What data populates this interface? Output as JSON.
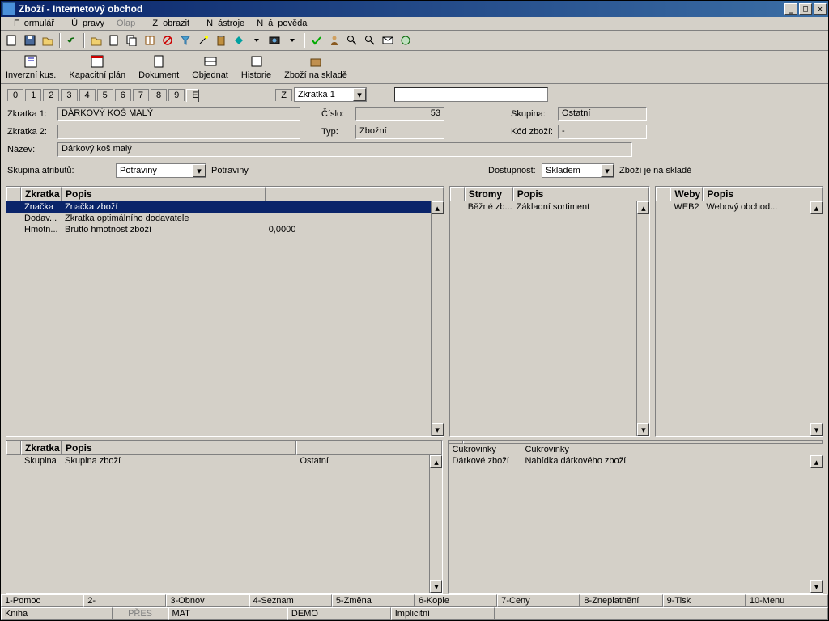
{
  "title": "Zboží - Internetový obchod",
  "menu": [
    "Formulář",
    "Úpravy",
    "Olap",
    "Zobrazit",
    "Nástroje",
    "Nápověda"
  ],
  "menu_underline": [
    0,
    0,
    null,
    0,
    0,
    1
  ],
  "actions": [
    "Inverzní kus.",
    "Kapacitní plán",
    "Dokument",
    "Objednat",
    "Historie",
    "Zboží na skladě"
  ],
  "tabs": [
    "0",
    "1",
    "2",
    "3",
    "4",
    "5",
    "6",
    "7",
    "8",
    "9",
    "E"
  ],
  "tab_active": 10,
  "zbtn": "Z",
  "zdropdown": "Zkratka 1",
  "form": {
    "zkratka1_label": "Zkratka 1:",
    "zkratka1_value": "DÁRKOVÝ KOŠ MALÝ",
    "cislo_label": "Číslo:",
    "cislo_value": "53",
    "skupina_label": "Skupina:",
    "skupina_value": "Ostatní",
    "zkratka2_label": "Zkratka 2:",
    "zkratka2_value": "",
    "typ_label": "Typ:",
    "typ_value": "Zbožní",
    "kod_label": "Kód zboží:",
    "kod_value": "-",
    "nazev_label": "Název:",
    "nazev_value": "Dárkový koš malý"
  },
  "attr_label": "Skupina atributů:",
  "attr_value": "Potraviny",
  "attr_text": "Potraviny",
  "avail_label": "Dostupnost:",
  "avail_value": "Skladem",
  "avail_text": "Zboží je na skladě",
  "grid1": {
    "cols": [
      "Zkratka",
      "Popis",
      ""
    ],
    "rows": [
      {
        "c0": "Značka",
        "c1": "Značka zboží",
        "c2": "",
        "sel": true
      },
      {
        "c0": "Dodav...",
        "c1": "Zkratka optimálního dodavatele",
        "c2": ""
      },
      {
        "c0": "Hmotn...",
        "c1": "Brutto hmotnost zboží",
        "c2": "0,0000"
      }
    ]
  },
  "grid2": {
    "cols": [
      "Stromy",
      "Popis"
    ],
    "rows": [
      {
        "c0": "Běžné zb...",
        "c1": "Základní sortiment"
      }
    ]
  },
  "grid3": {
    "cols": [
      "Weby",
      "Popis"
    ],
    "rows": [
      {
        "c0": "WEB2",
        "c1": "Webový obchod..."
      }
    ]
  },
  "grid4": {
    "cols": [
      "Zkratka",
      "Popis",
      ""
    ],
    "rows": [
      {
        "c0": "Skupina",
        "c1": "Skupina zboží",
        "c2": "Ostatní"
      }
    ]
  },
  "grid5": {
    "rows": [
      {
        "c0": "Cukrovinky",
        "c1": "Cukrovinky"
      },
      {
        "c0": "Dárkové zboží",
        "c1": "Nabídka dárkového zboží"
      }
    ]
  },
  "footer1": [
    "1-Pomoc",
    "2-",
    "3-Obnov",
    "4-Seznam",
    "5-Změna",
    "6-Kopie",
    "7-Ceny",
    "8-Zneplatnění",
    "9-Tisk",
    "10-Menu"
  ],
  "footer2": [
    "Kniha",
    "PŘES",
    "MAT",
    "DEMO",
    "Implicitní",
    ""
  ]
}
